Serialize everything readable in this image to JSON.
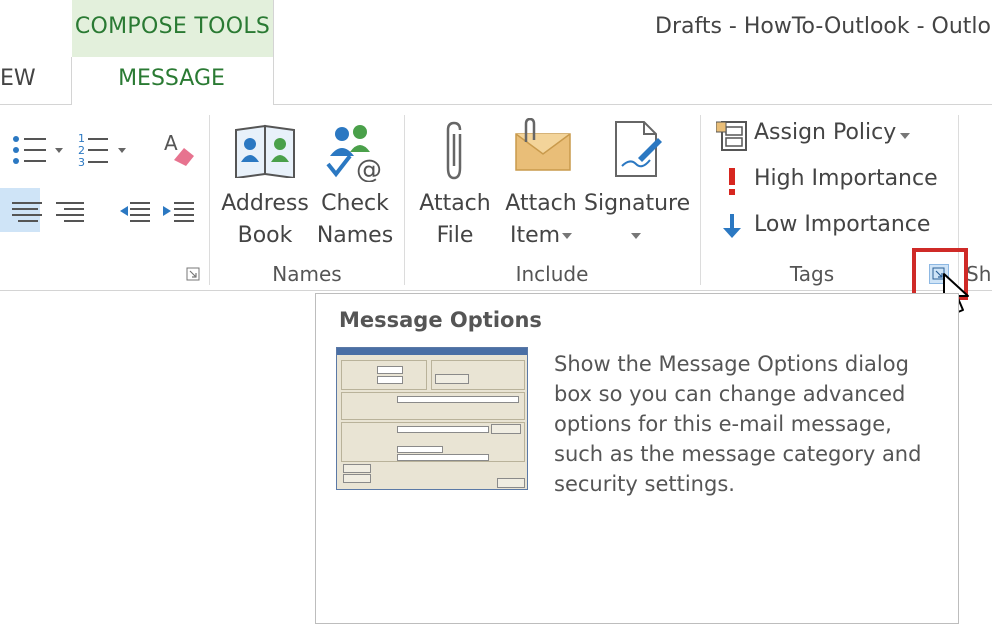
{
  "titlebar": {
    "context_tab": "COMPOSE TOOLS",
    "window_title": "Drafts - HowTo-Outlook - Outlo"
  },
  "tabs": {
    "partial_left": "EW",
    "active": "MESSAGE"
  },
  "ribbon": {
    "names_group": {
      "label": "Names",
      "address_book": [
        "Address",
        "Book"
      ],
      "check_names": [
        "Check",
        "Names"
      ]
    },
    "include_group": {
      "label": "Include",
      "attach_file": [
        "Attach",
        "File"
      ],
      "attach_item": [
        "Attach",
        "Item"
      ],
      "signature": "Signature"
    },
    "tags_group": {
      "label": "Tags",
      "assign_policy": "Assign Policy",
      "high_importance": "High Importance",
      "low_importance": "Low Importance"
    },
    "partial_right_group": "Sh"
  },
  "tooltip": {
    "title": "Message Options",
    "description": "Show the Message Options dialog box so you can change advanced options for this e-mail message, such as the message category and security settings."
  },
  "colors": {
    "accent_green": "#2a7a33",
    "context_tab_bg": "#e3f0dc",
    "highlight_red": "#cf2a27",
    "icon_blue": "#2b78c2"
  }
}
